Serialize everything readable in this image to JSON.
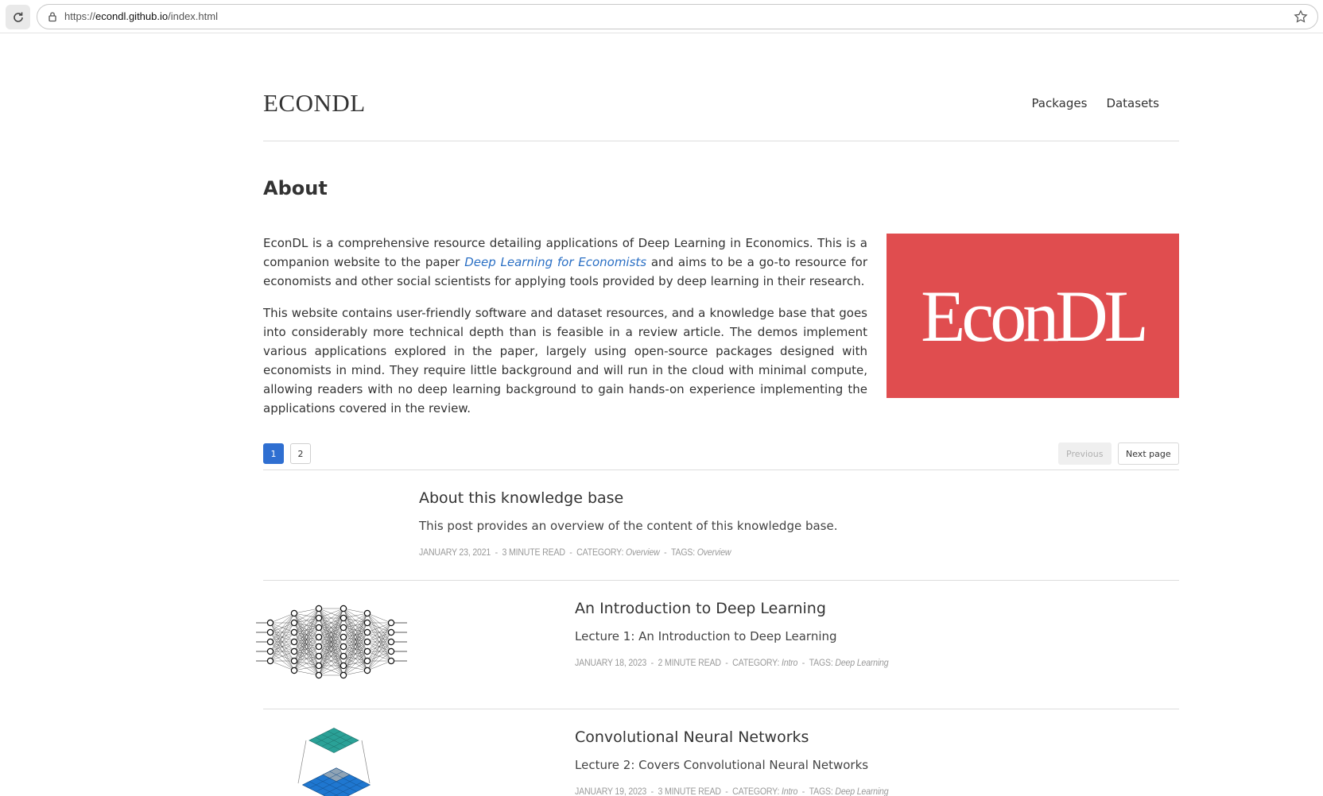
{
  "browser": {
    "url_prefix": "https://",
    "url_host": "econdl.github.io",
    "url_path": "/index.html"
  },
  "site": {
    "title": "ECONDL",
    "nav": [
      "Packages",
      "Datasets"
    ]
  },
  "about": {
    "heading": "About",
    "p1_before": "EconDL is a comprehensive resource detailing applications of Deep Learning in Economics. This is a companion website to the paper ",
    "p1_link": "Deep Learning for Economists",
    "p1_after": " and aims to be a go-to resource for economists and other social scientists for applying tools provided by deep learning in their research.",
    "p2": "This website contains user-friendly software and dataset resources, and a knowledge base that goes into considerably more technical depth than is feasible in a review article. The demos implement various applications explored in the paper, largely using open-source packages designed with economists in mind. They require little background and will run in the cloud with minimal compute, allowing readers with no deep learning background to gain hands-on experience implementing the applications covered in the review.",
    "logo_text": "EconDL",
    "logo_bg": "#e04d4f"
  },
  "pagination": {
    "pages": [
      "1",
      "2"
    ],
    "previous": "Previous",
    "next": "Next page"
  },
  "posts": [
    {
      "title": "About this knowledge base",
      "excerpt": "This post provides an overview of the content of this knowledge base.",
      "date": "January 23, 2021",
      "read": "3 minute read",
      "category_label": "Category:",
      "category": "Overview",
      "tags_label": "Tags:",
      "tags": "Overview"
    },
    {
      "title": "An Introduction to Deep Learning",
      "excerpt": "Lecture 1: An Introduction to Deep Learning",
      "date": "January 18, 2023",
      "read": "2 minute read",
      "category_label": "Category:",
      "category": "Intro",
      "tags_label": "Tags:",
      "tags": "Deep Learning",
      "thumb_icon": "neural-network-diagram"
    },
    {
      "title": "Convolutional Neural Networks",
      "excerpt": "Lecture 2: Covers Convolutional Neural Networks",
      "date": "January 19, 2023",
      "read": "3 minute read",
      "category_label": "Category:",
      "category": "Intro",
      "tags_label": "Tags:",
      "tags": "Deep Learning",
      "thumb_icon": "convolution-diagram"
    }
  ],
  "colors": {
    "accent": "#2f6fd1",
    "link": "#2a6fc4"
  }
}
